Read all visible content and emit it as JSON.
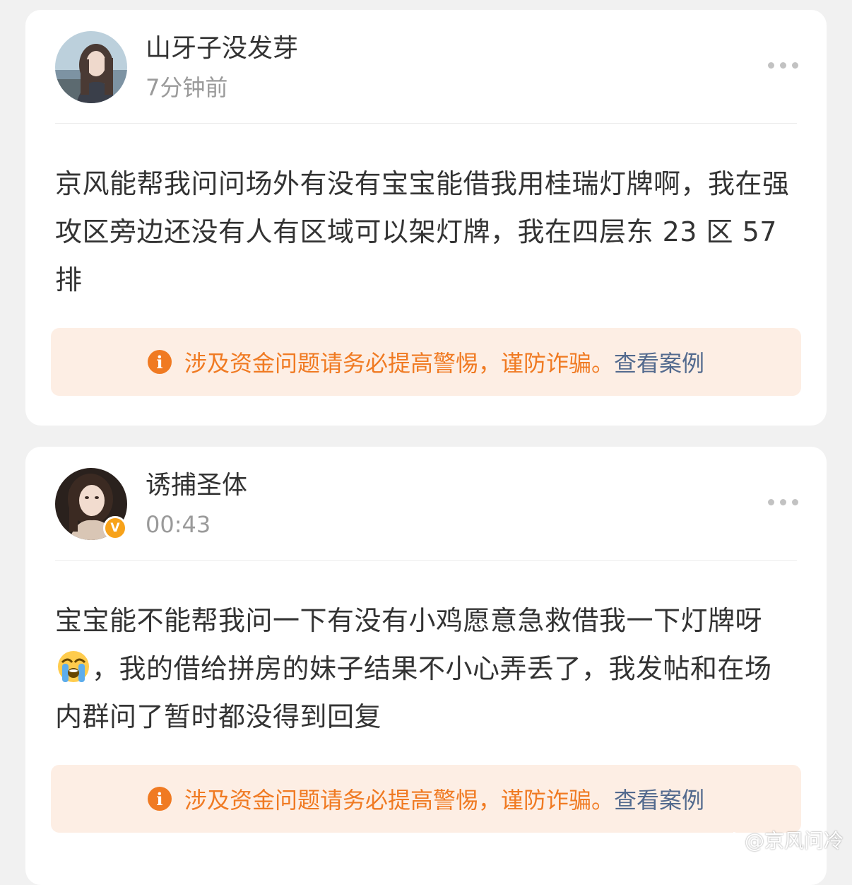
{
  "posts": [
    {
      "username": "山牙子没发芽",
      "time": "7分钟前",
      "verified": false,
      "content": "京风能帮我问问场外有没有宝宝能借我用桂瑞灯牌啊，我在强攻区旁边还没有人有区域可以架灯牌，我在四层东 23 区 57 排",
      "warning": {
        "icon": "info-icon",
        "text": "涉及资金问题请务必提高警惕，谨防诈骗。",
        "link": "查看案例"
      }
    },
    {
      "username": "诱捕圣体",
      "time": "00:43",
      "verified": true,
      "verified_mark": "V",
      "content_before_emoji": "宝宝能不能帮我问一下有没有小鸡愿意急救借我一下灯牌呀",
      "emoji": "loudly-crying-face-emoji",
      "content_after_emoji": "，我的借给拼房的妹子结果不小心弄丢了，我发帖和在场内群问了暂时都没得到回复",
      "warning": {
        "icon": "info-icon",
        "text": "涉及资金问题请务必提高警惕，谨防诈骗。",
        "link": "查看案例"
      }
    }
  ],
  "watermark": "@京风问冷",
  "colors": {
    "warning_text": "#f07a22",
    "warning_bg": "#fdeee4",
    "link": "#536a8e",
    "verified_badge": "#f7a21a"
  }
}
